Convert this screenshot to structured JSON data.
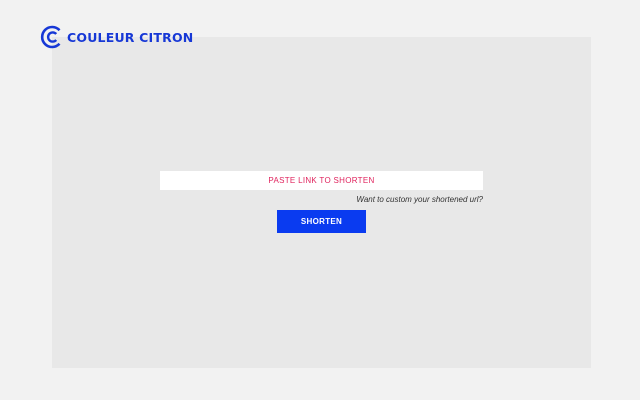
{
  "brand": {
    "name": "COULEUR CITRON",
    "logo_icon": "double-c-logo-icon",
    "color": "#1738d6"
  },
  "form": {
    "url_placeholder": "PASTE LINK TO SHORTEN",
    "url_value": "",
    "custom_link_label": "Want to custom your shortened url?",
    "shorten_label": "SHORTEN"
  },
  "colors": {
    "background": "#f2f2f2",
    "panel": "#e8e8e8",
    "accent": "#0a3bf0",
    "placeholder": "#e0245e"
  }
}
